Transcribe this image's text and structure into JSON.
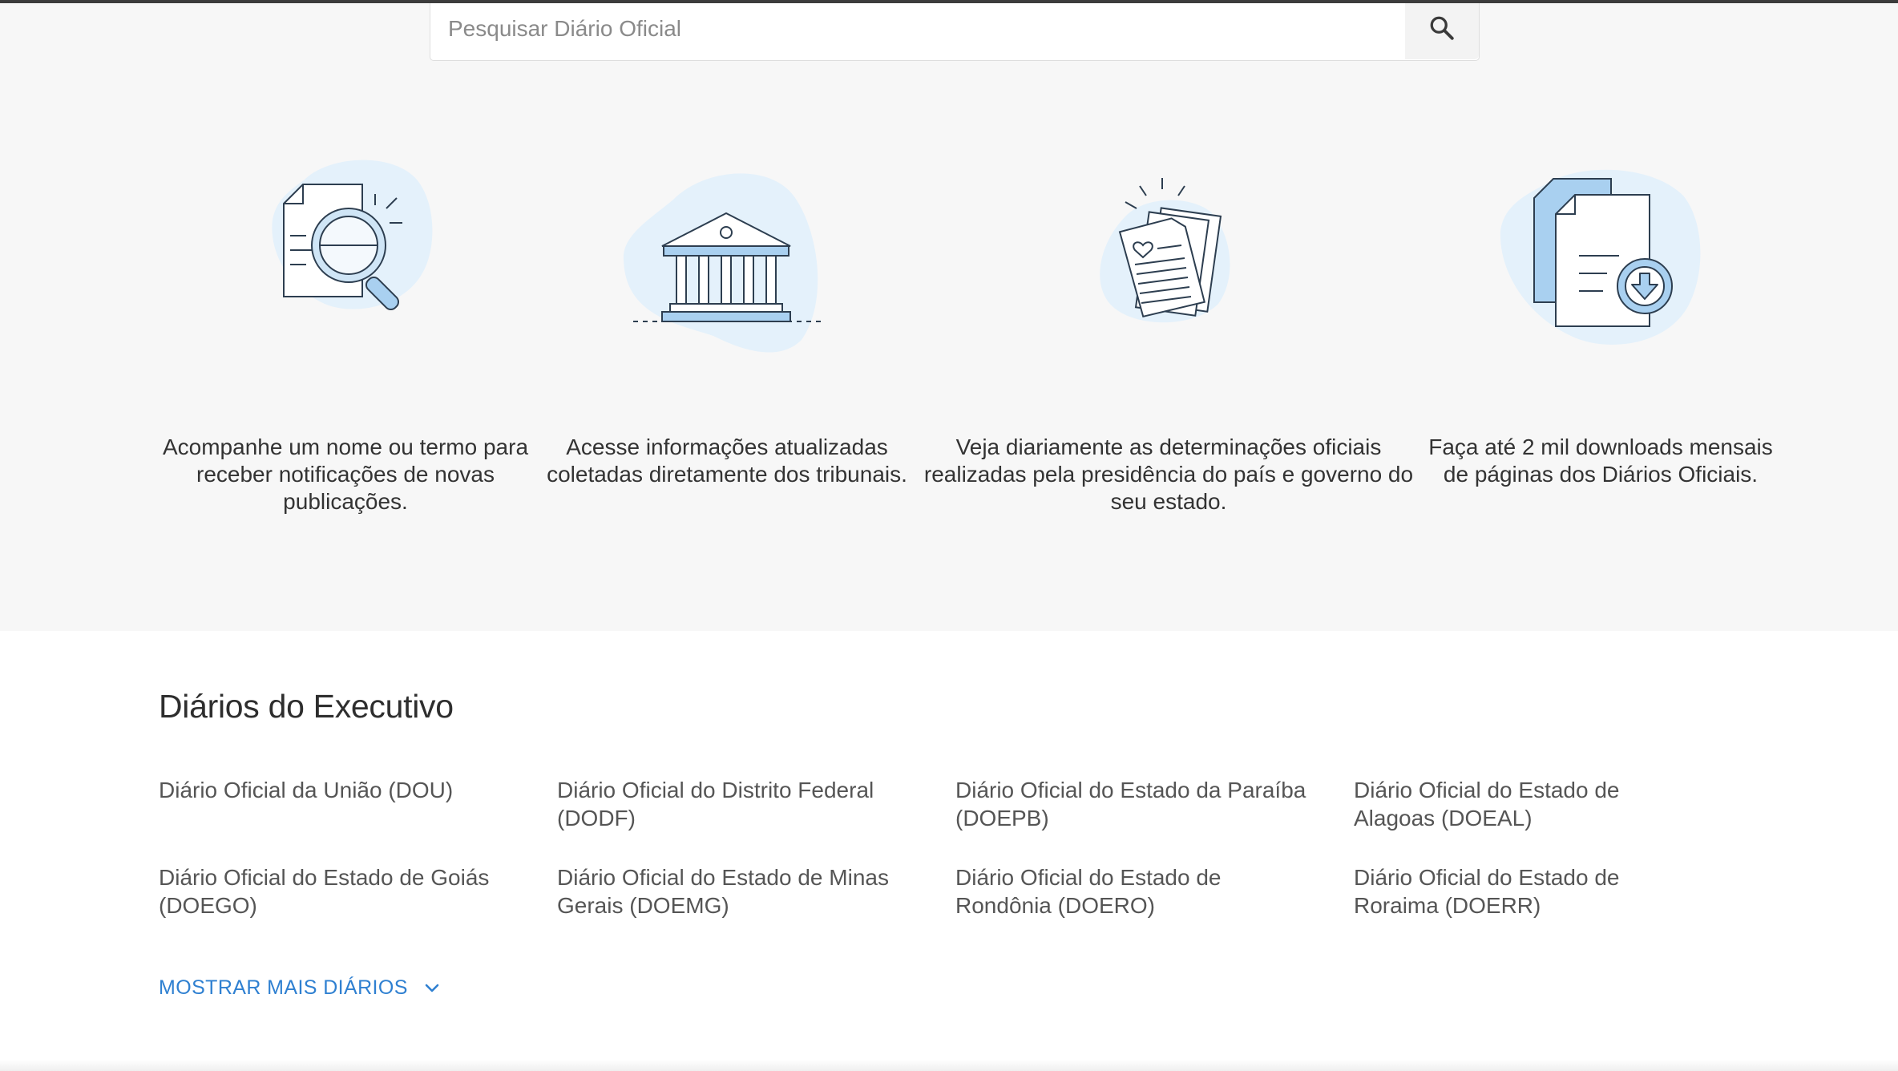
{
  "search": {
    "placeholder": "Pesquisar Diário Oficial"
  },
  "features": [
    {
      "icon": "magnifier-document-icon",
      "text": "Acompanhe um nome ou termo para receber notificações de novas publicações."
    },
    {
      "icon": "courthouse-icon",
      "text": "Acesse informações atualizadas coletadas diretamente dos tribunais."
    },
    {
      "icon": "documents-stack-icon",
      "text": "Veja diariamente as determinações oficiais realizadas pela presidência do país e governo do seu estado."
    },
    {
      "icon": "download-document-icon",
      "text": "Faça até 2 mil downloads mensais de páginas dos Diários Oficiais."
    }
  ],
  "executive": {
    "title": "Diários do Executivo",
    "links": [
      "Diário Oficial da União (DOU)",
      "Diário Oficial do Distrito Federal (DODF)",
      "Diário Oficial do Estado da Paraíba (DOEPB)",
      "Diário Oficial do Estado de Alagoas (DOEAL)",
      "Diário Oficial do Estado de Goiás (DOEGO)",
      "Diário Oficial do Estado de Minas Gerais (DOEMG)",
      "Diário Oficial do Estado de Rondônia (DOERO)",
      "Diário Oficial do Estado de Roraima (DOERR)"
    ],
    "show_more": "MOSTRAR MAIS DIÁRIOS"
  },
  "colors": {
    "accent": "#2f80d1",
    "illustration_blob": "#e4f1fb",
    "illustration_fill": "#a9d0f0",
    "illustration_stroke": "#2d3e50"
  }
}
